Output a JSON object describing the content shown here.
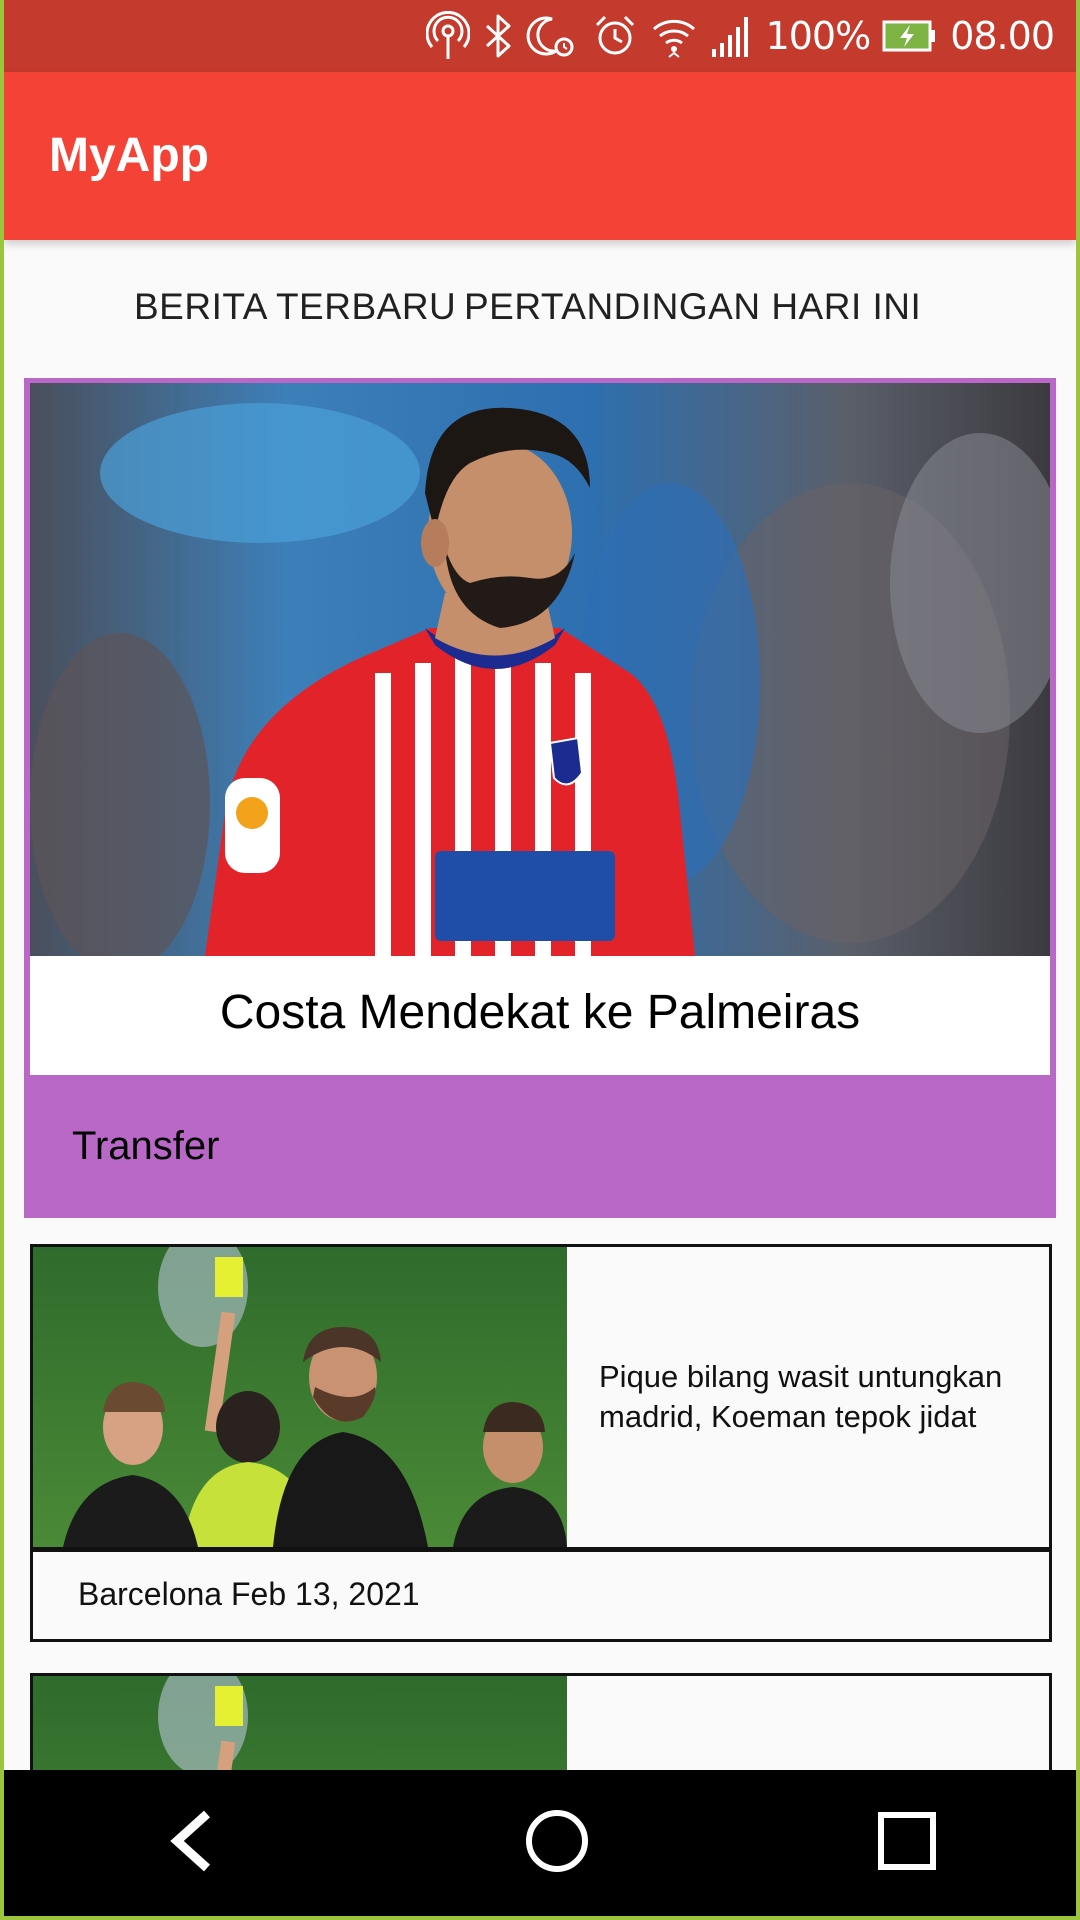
{
  "status_bar": {
    "battery_percent": "100%",
    "time": "08.00",
    "icons": [
      "hotspot-icon",
      "bluetooth-icon",
      "do-not-disturb-icon",
      "alarm-icon",
      "wifi-icon",
      "signal-icon",
      "battery-charging-icon"
    ],
    "battery_color": "#7cb342"
  },
  "app_bar": {
    "title": "MyApp",
    "color": "#f44336"
  },
  "tabs": [
    {
      "label": "BERITA TERBARU"
    },
    {
      "label": "PERTANDINGAN HARI INI"
    }
  ],
  "featured": {
    "title": "Costa Mendekat ke Palmeiras",
    "category": "Transfer",
    "image": "football-player-photo",
    "accent_color": "#ba68c8"
  },
  "news": [
    {
      "headline": "Pique bilang wasit untungkan madrid, Koeman tepok jidat",
      "meta": "Barcelona Feb 13, 2021",
      "image": "referee-yellow-card-photo"
    },
    {
      "headline": "",
      "meta": "",
      "image": "referee-yellow-card-photo"
    }
  ],
  "nav_bar": {
    "buttons": [
      "back-icon",
      "home-icon",
      "recent-apps-icon"
    ]
  }
}
